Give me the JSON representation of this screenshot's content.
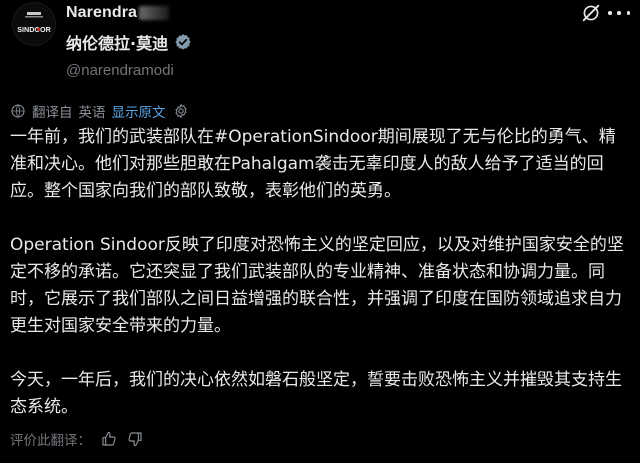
{
  "header": {
    "name": "Narendra",
    "cn_name": "纳伦德拉·莫迪",
    "handle": "@narendramodi",
    "avatar_text": "SINDOOR",
    "avatar_subtext": "OPERATION"
  },
  "translation": {
    "from_label": "翻译自",
    "language": "英语",
    "show_original": "显示原文"
  },
  "post": {
    "paragraphs": [
      "一年前，我们的武装部队在#OperationSindoor期间展现了无与伦比的勇气、精准和决心。他们对那些胆敢在Pahalgam袭击无辜印度人的敌人给予了适当的回应。整个国家向我们的部队致敬，表彰他们的英勇。",
      "Operation Sindoor反映了印度对恐怖主义的坚定回应，以及对维护国家安全的坚定不移的承诺。它还突显了我们武装部队的专业精神、准备状态和协调力量。同时，它展示了我们部队之间日益增强的联合性，并强调了印度在国防领域追求自力更生对国家安全带来的力量。",
      "今天，一年后，我们的决心依然如磐石般坚定，誓要击败恐怖主义并摧毁其支持生态系统。"
    ]
  },
  "footer": {
    "rate_label": "评价此翻译："
  },
  "colors": {
    "background": "#000000",
    "text": "#e7e9ea",
    "muted": "#71767b",
    "link": "#5aa7e8",
    "verified": "#829aab"
  },
  "icons": [
    "avatar",
    "verified-icon",
    "grok-icon",
    "more-icon",
    "translate-icon",
    "gear-icon",
    "thumbs-up-icon",
    "thumbs-down-icon"
  ]
}
